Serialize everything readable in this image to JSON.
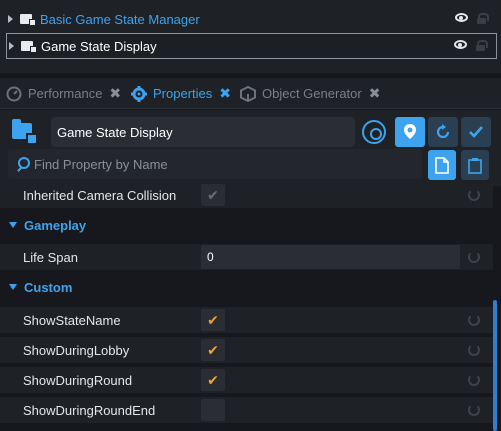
{
  "hierarchy": {
    "items": [
      {
        "label": "Basic Game State Manager"
      },
      {
        "label": "Game State Display"
      }
    ]
  },
  "tabs": [
    {
      "label": "Performance",
      "close": "✖"
    },
    {
      "label": "Properties",
      "close": "✖"
    },
    {
      "label": "Object Generator",
      "close": "✖"
    }
  ],
  "header": {
    "object_name": "Game State Display"
  },
  "search": {
    "placeholder": "Find Property by Name"
  },
  "properties": {
    "inherited_camera_collision": {
      "label": "Inherited Camera Collision",
      "checked": true
    },
    "gameplay": {
      "title": "Gameplay"
    },
    "life_span": {
      "label": "Life Span",
      "value": "0"
    },
    "custom": {
      "title": "Custom"
    },
    "show_state_name": {
      "label": "ShowStateName",
      "checked": true
    },
    "show_during_lobby": {
      "label": "ShowDuringLobby",
      "checked": true
    },
    "show_during_round": {
      "label": "ShowDuringRound",
      "checked": true
    },
    "show_during_round_end": {
      "label": "ShowDuringRoundEnd",
      "checked": false
    }
  },
  "colors": {
    "accent": "#3ea3ef",
    "check": "#f0a030",
    "panel": "#1e2126",
    "background": "#16181d"
  }
}
